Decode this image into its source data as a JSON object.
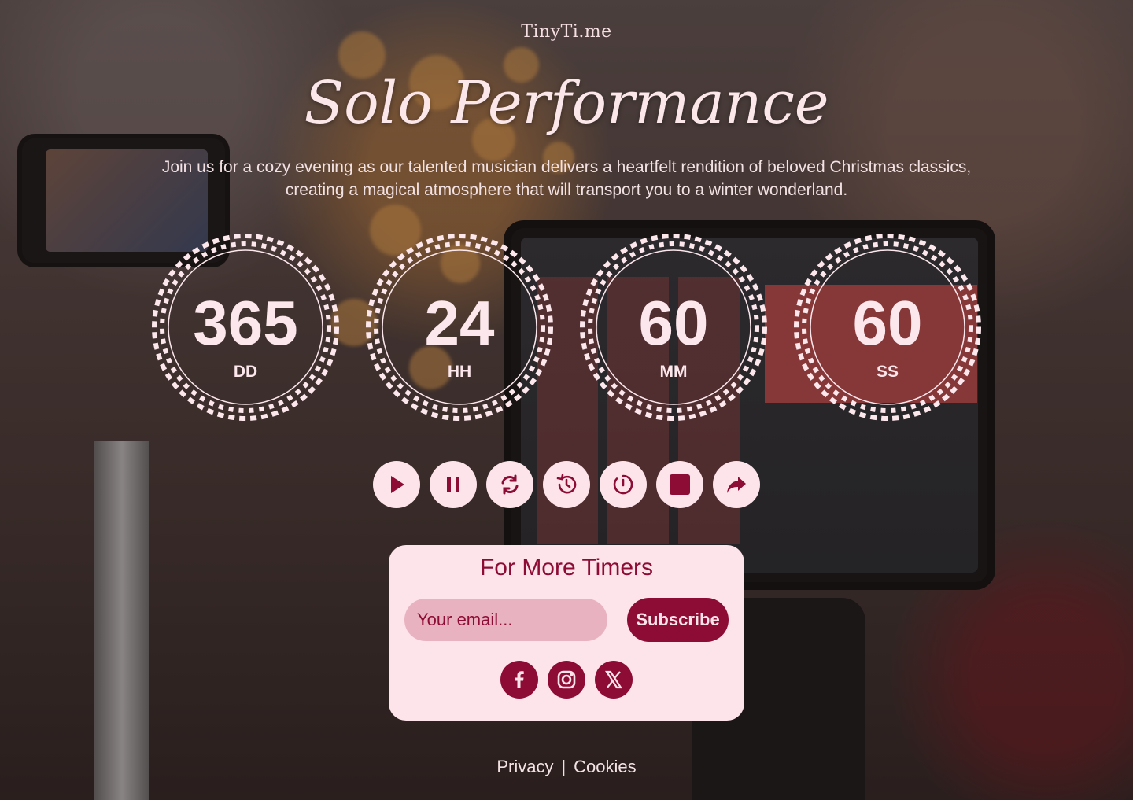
{
  "brand": "TinyTi.me",
  "title": "Solo Performance",
  "description": "Join us for a cozy evening as our talented musician delivers a heartfelt rendition of beloved Christmas classics, creating a magical atmosphere that will transport you to a winter wonderland.",
  "timer": {
    "units": [
      {
        "value": "365",
        "label": "DD"
      },
      {
        "value": "24",
        "label": "HH"
      },
      {
        "value": "60",
        "label": "MM"
      },
      {
        "value": "60",
        "label": "SS"
      }
    ]
  },
  "controls": [
    {
      "name": "play-button",
      "icon": "play-icon"
    },
    {
      "name": "pause-button",
      "icon": "pause-icon"
    },
    {
      "name": "restart-button",
      "icon": "refresh-icon"
    },
    {
      "name": "history-button",
      "icon": "history-icon"
    },
    {
      "name": "reset-button",
      "icon": "timer-reset-icon"
    },
    {
      "name": "stop-button",
      "icon": "stop-icon"
    },
    {
      "name": "share-button",
      "icon": "share-icon"
    }
  ],
  "newsletter": {
    "title": "For More Timers",
    "email_placeholder": "Your email...",
    "subscribe_label": "Subscribe",
    "socials": [
      "facebook-icon",
      "instagram-icon",
      "x-icon"
    ]
  },
  "footer": {
    "privacy": "Privacy",
    "separator": "|",
    "cookies": "Cookies"
  },
  "colors": {
    "accent": "#8c0c35",
    "light": "#fde3ea",
    "input_bg": "#e8b2c0"
  }
}
